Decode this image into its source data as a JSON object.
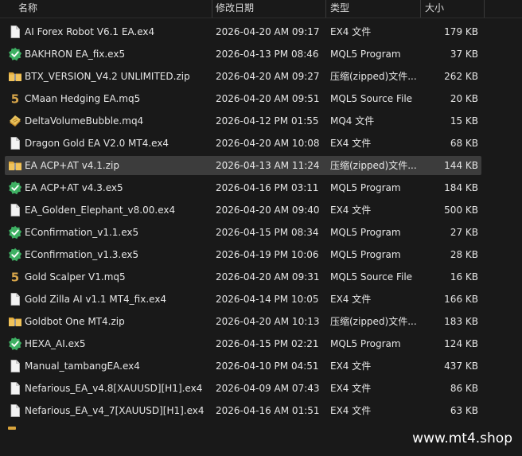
{
  "header": {
    "name": "名称",
    "date": "修改日期",
    "type": "类型",
    "size": "大小"
  },
  "colors": {
    "background": "#191919",
    "selected": "#3c3c3c",
    "text": "#e6e6e6",
    "mql5_icon": "#3eb063",
    "mq_icon": "#d8a64a",
    "folder_zip": "#e9b94d"
  },
  "files": [
    {
      "name": "AI Forex Robot V6.1 EA.ex4",
      "date": "2026-04-20 AM 09:17",
      "type": "EX4 文件",
      "size": "179 KB",
      "icon": "file-icon"
    },
    {
      "name": "BAKHRON EA_fix.ex5",
      "date": "2026-04-13 PM 08:46",
      "type": "MQL5 Program",
      "size": "37 KB",
      "icon": "mql5-program-icon"
    },
    {
      "name": "BTX_VERSION_V4.2 UNLIMITED.zip",
      "date": "2026-04-20 AM 09:27",
      "type": "压缩(zipped)文件...",
      "size": "262 KB",
      "icon": "zip-folder-icon"
    },
    {
      "name": "CMaan Hedging EA.mq5",
      "date": "2026-04-20 AM 09:51",
      "type": "MQL5 Source File",
      "size": "20 KB",
      "icon": "mq5-source-icon"
    },
    {
      "name": "DeltaVolumeBubble.mq4",
      "date": "2026-04-12 PM 01:55",
      "type": "MQ4 文件",
      "size": "15 KB",
      "icon": "mq4-source-icon"
    },
    {
      "name": "Dragon Gold EA V2.0 MT4.ex4",
      "date": "2026-04-20 AM 10:08",
      "type": "EX4 文件",
      "size": "68 KB",
      "icon": "file-icon"
    },
    {
      "name": "EA ACP+AT v4.1.zip",
      "date": "2026-04-13 AM 11:24",
      "type": "压缩(zipped)文件...",
      "size": "144 KB",
      "icon": "zip-folder-icon",
      "selected": true
    },
    {
      "name": "EA ACP+AT v4.3.ex5",
      "date": "2026-04-16 PM 03:11",
      "type": "MQL5 Program",
      "size": "184 KB",
      "icon": "mql5-program-icon"
    },
    {
      "name": "EA_Golden_Elephant_v8.00.ex4",
      "date": "2026-04-20 AM 09:40",
      "type": "EX4 文件",
      "size": "500 KB",
      "icon": "file-icon"
    },
    {
      "name": "EConfirmation_v1.1.ex5",
      "date": "2026-04-15 PM 08:34",
      "type": "MQL5 Program",
      "size": "27 KB",
      "icon": "mql5-program-icon"
    },
    {
      "name": "EConfirmation_v1.3.ex5",
      "date": "2026-04-19 PM 10:06",
      "type": "MQL5 Program",
      "size": "28 KB",
      "icon": "mql5-program-icon"
    },
    {
      "name": "Gold Scalper V1.mq5",
      "date": "2026-04-20 AM 09:31",
      "type": "MQL5 Source File",
      "size": "16 KB",
      "icon": "mq5-source-icon"
    },
    {
      "name": "Gold Zilla AI v1.1 MT4_fix.ex4",
      "date": "2026-04-14 PM 10:05",
      "type": "EX4 文件",
      "size": "166 KB",
      "icon": "file-icon"
    },
    {
      "name": "Goldbot One MT4.zip",
      "date": "2026-04-20 AM 10:13",
      "type": "压缩(zipped)文件...",
      "size": "183 KB",
      "icon": "zip-folder-icon"
    },
    {
      "name": "HEXA_AI.ex5",
      "date": "2026-04-15 PM 02:21",
      "type": "MQL5 Program",
      "size": "124 KB",
      "icon": "mql5-program-icon"
    },
    {
      "name": "Manual_tambangEA.ex4",
      "date": "2026-04-10 PM 04:51",
      "type": "EX4 文件",
      "size": "437 KB",
      "icon": "file-icon"
    },
    {
      "name": "Nefarious_EA_v4.8[XAUUSD][H1].ex4",
      "date": "2026-04-09 AM 07:43",
      "type": "EX4 文件",
      "size": "86 KB",
      "icon": "file-icon"
    },
    {
      "name": "Nefarious_EA_v4_7[XAUUSD][H1].ex4",
      "date": "2026-04-16 AM 01:51",
      "type": "EX4 文件",
      "size": "63 KB",
      "icon": "file-icon"
    }
  ],
  "watermark": "www.mt4.shop"
}
